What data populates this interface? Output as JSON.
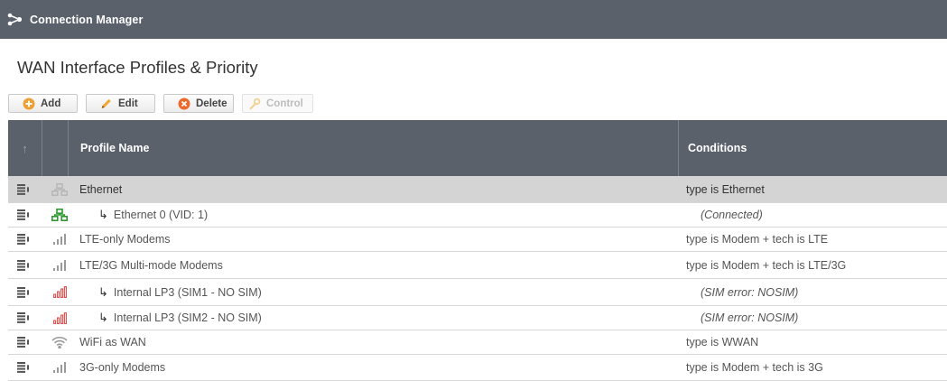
{
  "app": {
    "title": "Connection Manager"
  },
  "page": {
    "title": "WAN Interface Profiles & Priority"
  },
  "toolbar": {
    "add_label": "Add",
    "edit_label": "Edit",
    "delete_label": "Delete",
    "control_label": "Control"
  },
  "table": {
    "sort_arrow": "↑",
    "headers": {
      "profile_name": "Profile Name",
      "conditions": "Conditions"
    },
    "rows": [
      {
        "name": "Ethernet",
        "condition": "type is Ethernet",
        "icon": "ethernet-network-icon",
        "child": false,
        "selected": true
      },
      {
        "name": "Ethernet 0 (VID: 1)",
        "condition": "(Connected)",
        "icon": "ethernet-network-icon",
        "child": true,
        "selected": false
      },
      {
        "name": "LTE-only Modems",
        "condition": "type is Modem + tech is LTE",
        "icon": "signal-bars-icon",
        "child": false,
        "selected": false
      },
      {
        "name": "LTE/3G Multi-mode Modems",
        "condition": "type is Modem + tech is LTE/3G",
        "icon": "signal-bars-icon",
        "child": false,
        "selected": false
      },
      {
        "name": "Internal LP3 (SIM1 - NO SIM)",
        "condition": "(SIM error: NOSIM)",
        "icon": "signal-bars-error-icon",
        "child": true,
        "selected": false
      },
      {
        "name": "Internal LP3 (SIM2 - NO SIM)",
        "condition": "(SIM error: NOSIM)",
        "icon": "signal-bars-error-icon",
        "child": true,
        "selected": false
      },
      {
        "name": "WiFi as WAN",
        "condition": "type is WWAN",
        "icon": "wifi-icon",
        "child": false,
        "selected": false
      },
      {
        "name": "3G-only Modems",
        "condition": "type is Modem + tech is 3G",
        "icon": "signal-bars-icon",
        "child": false,
        "selected": false
      }
    ]
  },
  "colors": {
    "header_bg": "#5a616b",
    "selected_row": "#d4d4d4",
    "connected_green": "#2e9a2e",
    "error_red": "#e34d4d",
    "add_orange": "#f0a030",
    "delete_orange": "#ec6a2c"
  }
}
